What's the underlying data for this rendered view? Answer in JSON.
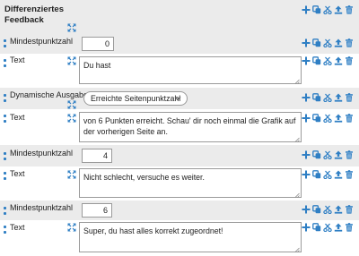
{
  "colors": {
    "accent": "#2f7fc4",
    "row_grey": "#ebebeb",
    "border": "#9a9a9a"
  },
  "header": {
    "title": "Differenziertes Feedback"
  },
  "rows": [
    {
      "label": "Mindestpunktzahl",
      "type": "number",
      "value": "0"
    },
    {
      "label": "Text",
      "type": "text",
      "value": "Du hast"
    },
    {
      "label": "Dynamische Ausgabe",
      "type": "select",
      "value": "Erreichte Seitenpunktzahl"
    },
    {
      "label": "Text",
      "type": "text",
      "value": "von 6 Punkten erreicht. Schau' dir noch einmal die Grafik auf der vorherigen Seite an."
    },
    {
      "label": "Mindestpunktzahl",
      "type": "number",
      "value": "4"
    },
    {
      "label": "Text",
      "type": "text",
      "value": "Nicht schlecht, versuche es weiter."
    },
    {
      "label": "Mindestpunktzahl",
      "type": "number",
      "value": "6"
    },
    {
      "label": "Text",
      "type": "text",
      "value": "Super, du hast alles korrekt zugeordnet!"
    }
  ],
  "action_icons": [
    "plus-icon",
    "copy-icon",
    "cut-icon",
    "move-up-icon",
    "trash-icon"
  ],
  "drag_icon": "drag-handle-icon",
  "expand_icon": "expand-icon"
}
